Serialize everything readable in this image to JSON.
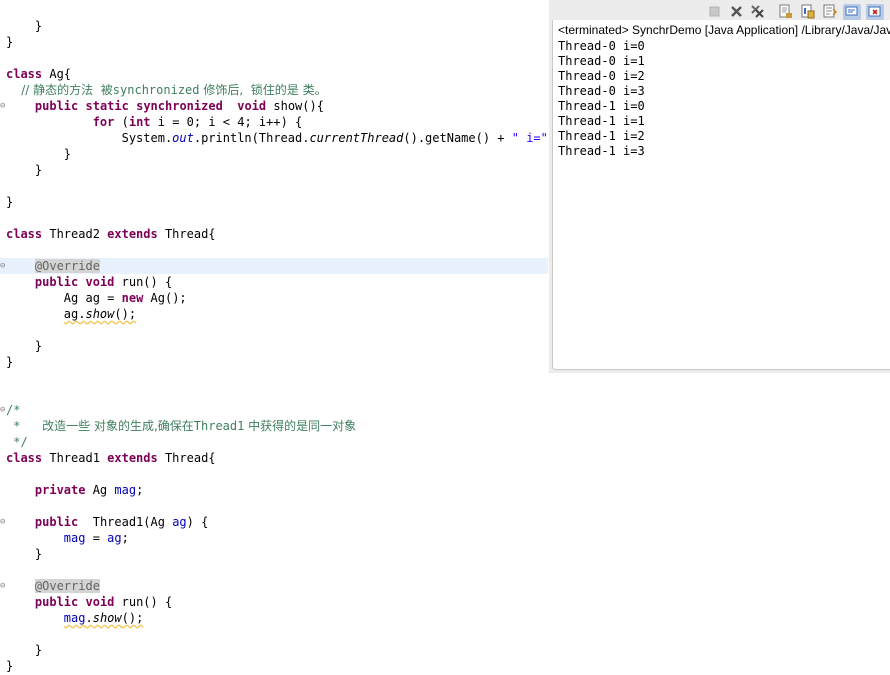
{
  "editor": {
    "lines": {
      "l1": "    }",
      "l2": "}",
      "l4a": "class",
      "l4b": " Ag{",
      "l5cmt_a": "    // 静态的方法  被",
      "l5cmt_b": "synchronized",
      "l5cmt_c": " 修饰后,  锁住的是 类。",
      "l6a": "public",
      "l6b": "static",
      "l6c": "synchronized",
      "l6d": "void",
      "l6e": " show(){",
      "l7a": "for",
      "l7b": " (",
      "l7c": "int",
      "l7d": " i = 0; i < 4; i++) {",
      "l8a": "System.",
      "l8b": "out",
      "l8c": ".println(Thread.",
      "l8d": "currentThread",
      "l8e": "().getName() + ",
      "l8f": "\" i=\"",
      "l8g": " +",
      "l9": "        }",
      "l10": "    }",
      "l12": "}",
      "l14a": "class",
      "l14b": " Thread2 ",
      "l14c": "extends",
      "l14d": " Thread{",
      "l16": "@Override",
      "l17a": "public",
      "l17b": "void",
      "l17c": " run() {",
      "l18a": "Ag ",
      "l18b": "ag",
      "l18c": " = ",
      "l18d": "new",
      "l18e": " Ag();",
      "l19a": "ag",
      "l19b": ".",
      "l19c": "show",
      "l19d": "();",
      "l21": "    }",
      "l22": "}",
      "l25": "/*",
      "l26a": " *   ",
      "l26b": "改造一些 对象的生成,确保在",
      "l26c": "Thread1",
      "l26d": " 中获得的是同一对象",
      "l27": " */",
      "l28a": "class",
      "l28b": " Thread1 ",
      "l28c": "extends",
      "l28d": " Thread{",
      "l30a": "private",
      "l30b": " Ag ",
      "l30c": "mag",
      "l30d": ";",
      "l32a": "public",
      "l32b": "  Thread1(Ag ",
      "l32c": "ag",
      "l32d": ") {",
      "l33a": "mag",
      "l33b": " = ",
      "l33c": "ag",
      "l33d": ";",
      "l34": "    }",
      "l36": "@Override",
      "l37a": "public",
      "l37b": "void",
      "l37c": " run() {",
      "l38a": "mag",
      "l38b": ".",
      "l38c": "show",
      "l38d": "();",
      "l40": "    }",
      "l41": "}"
    }
  },
  "console": {
    "status": "<terminated> SynchrDemo [Java Application] /Library/Java/JavaVirtualMachines",
    "output": [
      "Thread-0 i=0",
      "Thread-0 i=1",
      "Thread-0 i=2",
      "Thread-0 i=3",
      "Thread-1 i=0",
      "Thread-1 i=1",
      "Thread-1 i=2",
      "Thread-1 i=3"
    ],
    "toolbar_icons": [
      "terminate-icon",
      "remove-launch-icon",
      "remove-all-terminated-icon",
      "clear-console-icon",
      "scroll-lock-icon",
      "word-wrap-icon",
      "pin-console-icon",
      "display-selected-console-icon"
    ]
  },
  "colors": {
    "keyword": "#7f0055",
    "comment": "#3f7f5f",
    "field": "#0000c0",
    "string": "#2a00ff",
    "current_line": "#e8f2fe"
  }
}
